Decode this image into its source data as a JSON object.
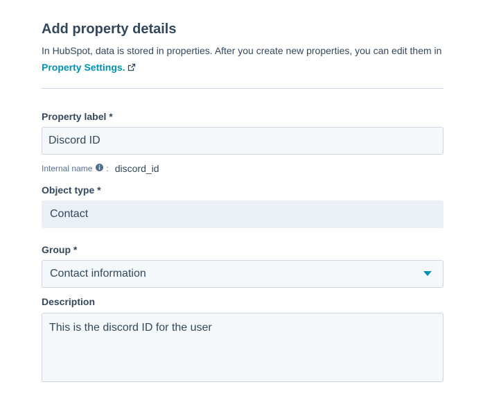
{
  "header": {
    "title": "Add property details",
    "intro_text": "In HubSpot, data is stored in properties. After you create new properties, you can edit them in",
    "link_label": "Property Settings.",
    "link_icon": "external-link-icon"
  },
  "fields": {
    "property_label": {
      "label": "Property label *",
      "value": "Discord ID"
    },
    "internal_name": {
      "label": "Internal name",
      "info_icon": "info-icon",
      "separator": ":",
      "value": "discord_id"
    },
    "object_type": {
      "label": "Object type *",
      "value": "Contact"
    },
    "group": {
      "label": "Group *",
      "value": "Contact information",
      "icon": "caret-down-icon"
    },
    "description": {
      "label": "Description",
      "value": "This is the discord ID for the user"
    }
  },
  "colors": {
    "text": "#33475b",
    "link": "#0091ae",
    "input_bg": "#f5f8fa",
    "input_border": "#cbd6e2",
    "disabled_bg": "#eaf0f6"
  }
}
